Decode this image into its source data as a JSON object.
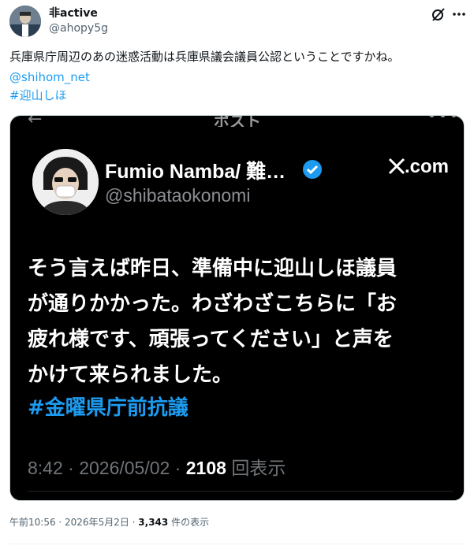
{
  "post": {
    "display_name": "非active",
    "handle": "@ahopy5g",
    "text": "兵庫県庁周辺のあの迷惑活動は兵庫県議会議員公認ということですかね。",
    "mention": "@shihom_net",
    "hashtag": "#迎山しほ",
    "timestamp": "午前10:56 · 2026年5月2日",
    "separator": " · ",
    "views": "3,343",
    "views_suffix": " 件の表示"
  },
  "icons": {
    "grok": "grok-icon",
    "more": "more-icon",
    "verified": "verified-icon",
    "x_logo": "x-logo-icon"
  },
  "embedded": {
    "top_title": "ポスト",
    "display_name": "Fumio Namba/ 難…",
    "source": ".com",
    "handle": "@shibataokonomi",
    "body_lines": [
      "そう言えば昨日、準備中に迎山しほ議員",
      "が通りかかった。わざわざこちらに「お",
      "疲れ様です、頑張ってください」と声を",
      "かけて来られました。"
    ],
    "hashtag": "#金曜県庁前抗議",
    "time": "8:42 · 2026/05/02 · ",
    "view_count": "2108",
    "view_label": " 回表示"
  },
  "colors": {
    "link": "#1d9bf0",
    "text": "#0f1419",
    "secondary": "#536471",
    "media_bg": "#000000"
  }
}
